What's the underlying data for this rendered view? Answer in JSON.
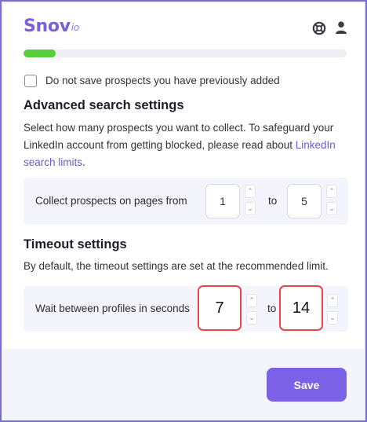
{
  "header": {
    "logo_text": "Snov",
    "logo_suffix": "io",
    "help_icon": "lifebuoy-icon",
    "user_icon": "user-icon"
  },
  "progress": {
    "value": 0.1,
    "color": "#57cf3c"
  },
  "skip_saved": {
    "label": "Do not save prospects you have previously added",
    "checked": false
  },
  "advanced": {
    "title": "Advanced search settings",
    "description": "Select how many prospects you want to collect. To safeguard your LinkedIn account from getting blocked, please read about ",
    "link_text": "LinkedIn search limits",
    "description_end": ".",
    "pages_label": "Collect prospects on pages from",
    "from_value": "1",
    "to_label": "to",
    "to_value": "5"
  },
  "timeout": {
    "title": "Timeout settings",
    "description": "By default, the timeout settings are set at the recommended limit.",
    "wait_label": "Wait between profiles in seconds",
    "min_value": "7",
    "to_label": "to",
    "max_value": "14"
  },
  "footer": {
    "save_label": "Save"
  },
  "colors": {
    "accent": "#7b61e6",
    "highlight": "#e5474f",
    "frame": "#7a6cd8"
  }
}
